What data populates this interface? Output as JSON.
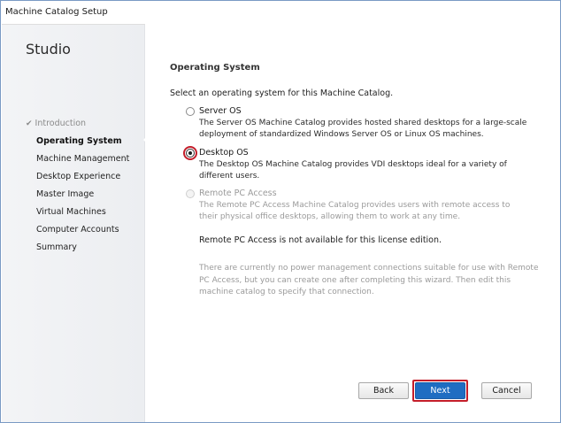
{
  "window": {
    "title": "Machine Catalog Setup"
  },
  "sidebar": {
    "heading": "Studio",
    "steps": [
      {
        "label": "Introduction",
        "state": "done"
      },
      {
        "label": "Operating System",
        "state": "active"
      },
      {
        "label": "Machine Management",
        "state": "pending"
      },
      {
        "label": "Desktop Experience",
        "state": "pending"
      },
      {
        "label": "Master Image",
        "state": "pending"
      },
      {
        "label": "Virtual Machines",
        "state": "pending"
      },
      {
        "label": "Computer Accounts",
        "state": "pending"
      },
      {
        "label": "Summary",
        "state": "pending"
      }
    ]
  },
  "main": {
    "section_title": "Operating System",
    "instruction": "Select an operating system for this Machine Catalog.",
    "options": [
      {
        "label": "Server OS",
        "description": "The Server OS Machine Catalog provides hosted shared desktops for a large-scale deployment of standardized Windows Server OS or Linux OS machines.",
        "selected": false,
        "enabled": true
      },
      {
        "label": "Desktop OS",
        "description": "The Desktop OS Machine Catalog provides VDI desktops ideal for a variety of different users.",
        "selected": true,
        "enabled": true
      },
      {
        "label": "Remote PC Access",
        "description": "The Remote PC Access Machine Catalog provides users with remote access to their physical office desktops, allowing them to work at any time.",
        "selected": false,
        "enabled": false
      }
    ],
    "license_note": "Remote PC Access is not available for this license edition.",
    "power_note": "There are currently no power management connections suitable for use with Remote PC Access, but you can create one after completing this wizard. Then edit this machine catalog to specify that connection."
  },
  "buttons": {
    "back": "Back",
    "next": "Next",
    "cancel": "Cancel"
  },
  "colors": {
    "highlight": "#c41e2a",
    "primary_button": "#1f6dc2",
    "disabled_text": "#9a9a9a"
  }
}
